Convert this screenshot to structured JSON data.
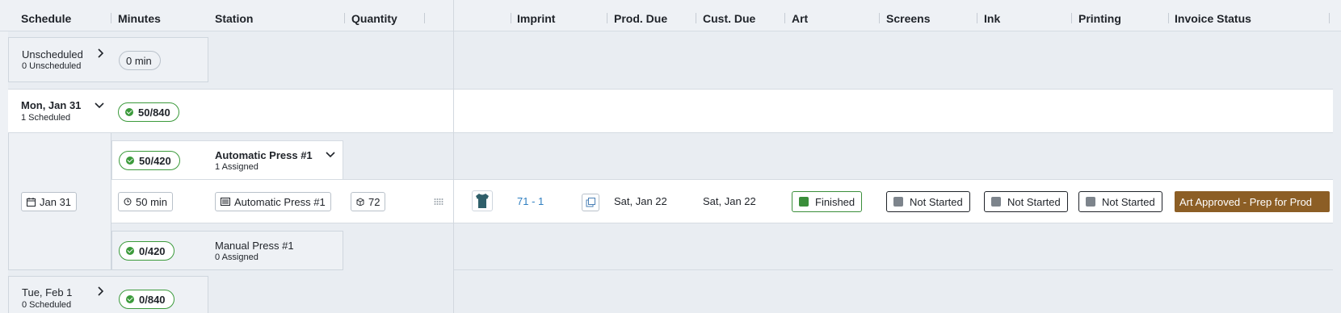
{
  "columns": {
    "schedule": "Schedule",
    "minutes": "Minutes",
    "station": "Station",
    "quantity": "Quantity",
    "imprint": "Imprint",
    "prod_due": "Prod. Due",
    "cust_due": "Cust. Due",
    "art": "Art",
    "screens": "Screens",
    "ink": "Ink",
    "printing": "Printing",
    "invoice_status": "Invoice Status"
  },
  "unscheduled": {
    "title": "Unscheduled",
    "subtitle": "0 Unscheduled",
    "minutes": "0 min"
  },
  "day1": {
    "title": "Mon, Jan 31",
    "subtitle": "1 Scheduled",
    "capacity": "50/840",
    "date_chip": "Jan 31",
    "stations": [
      {
        "capacity": "50/420",
        "name": "Automatic Press #1",
        "assigned": "1 Assigned"
      },
      {
        "capacity": "0/420",
        "name": "Manual Press #1",
        "assigned": "0 Assigned"
      }
    ],
    "job": {
      "minutes": "50 min",
      "station": "Automatic Press #1",
      "quantity": "72",
      "imprint": "71 - 1",
      "prod_due": "Sat, Jan 22",
      "cust_due": "Sat, Jan 22",
      "art": "Finished",
      "screens": "Not Started",
      "ink": "Not Started",
      "printing": "Not Started",
      "invoice_status": "Art Approved - Prep for Prod"
    }
  },
  "day2": {
    "title": "Tue, Feb 1",
    "subtitle": "0 Scheduled",
    "capacity": "0/840"
  },
  "colors": {
    "accent_green": "#3b9a3b",
    "finished": "#3a8e3a",
    "not_started": "#7d848c",
    "invoice_bg": "#8c5e25",
    "link": "#2f7fc1",
    "shirt": "#2f5f6a"
  }
}
